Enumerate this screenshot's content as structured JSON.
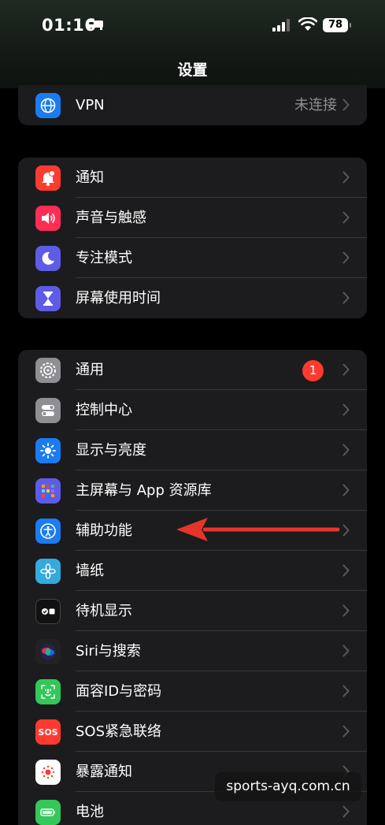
{
  "status_bar": {
    "time": "01:16",
    "battery": "78"
  },
  "nav": {
    "title": "设置"
  },
  "groups": [
    {
      "items": [
        {
          "label": "VPN",
          "value": "未连接",
          "icon": "vpn-globe-icon",
          "color": "#1a7cf0"
        }
      ]
    },
    {
      "items": [
        {
          "label": "通知",
          "icon": "bell-icon",
          "color": "#ff3b30"
        },
        {
          "label": "声音与触感",
          "icon": "speaker-icon",
          "color": "#ff2d55"
        },
        {
          "label": "专注模式",
          "icon": "moon-icon",
          "color": "#5e5ce6"
        },
        {
          "label": "屏幕使用时间",
          "icon": "hourglass-icon",
          "color": "#5e5ce6"
        }
      ]
    },
    {
      "items": [
        {
          "label": "通用",
          "icon": "gear-icon",
          "color": "#8e8e93",
          "badge": "1"
        },
        {
          "label": "控制中心",
          "icon": "toggles-icon",
          "color": "#8e8e93"
        },
        {
          "label": "显示与亮度",
          "icon": "sun-icon",
          "color": "#1a7cf0"
        },
        {
          "label": "主屏幕与 App 资源库",
          "icon": "app-grid-icon",
          "color": "#5e5ce6"
        },
        {
          "label": "辅助功能",
          "icon": "accessibility-icon",
          "color": "#1a7cf0"
        },
        {
          "label": "墙纸",
          "icon": "flower-icon",
          "color": "#35aadc"
        },
        {
          "label": "待机显示",
          "icon": "standby-icon",
          "color": "#111111"
        },
        {
          "label": "Siri与搜索",
          "icon": "siri-icon",
          "color": "#222222"
        },
        {
          "label": "面容ID与密码",
          "icon": "faceid-icon",
          "color": "#34c759"
        },
        {
          "label": "SOS紧急联络",
          "icon": "sos-icon",
          "color": "#ff3b30"
        },
        {
          "label": "暴露通知",
          "icon": "exposure-icon",
          "color": "#ffffff"
        },
        {
          "label": "电池",
          "icon": "battery-icon",
          "color": "#34c759"
        }
      ]
    }
  ],
  "annotation": {
    "arrow_color": "#e5352b"
  },
  "watermark": {
    "text": "sports-ayq.com.cn"
  }
}
